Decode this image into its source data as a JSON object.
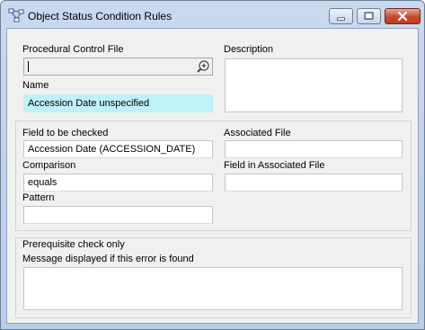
{
  "window": {
    "title": "Object Status Condition Rules",
    "icon": "flow-diagram-icon",
    "buttons": [
      "minimize-icon",
      "maximize-icon",
      "close-icon"
    ]
  },
  "form": {
    "procedural_control_file": {
      "label": "Procedural Control File",
      "value": "",
      "browse_icon": "zoom-in-icon"
    },
    "name": {
      "label": "Name",
      "value": "Accession Date unspecified"
    },
    "description": {
      "label": "Description",
      "value": ""
    },
    "field_to_check": {
      "label": "Field to be checked",
      "value": "Accession Date (ACCESSION_DATE)"
    },
    "comparison": {
      "label": "Comparison",
      "value": "equals"
    },
    "pattern": {
      "label": "Pattern",
      "value": ""
    },
    "associated_file": {
      "label": "Associated File",
      "value": ""
    },
    "field_in_associated_file": {
      "label": "Field in Associated File",
      "value": ""
    },
    "prerequisite": {
      "label": "Prerequisite check only"
    },
    "message": {
      "label": "Message displayed if this error is found",
      "value": ""
    }
  },
  "colors": {
    "name_field_background": "#bff1f8",
    "titlebar": "#c9d9ee",
    "close_button": "#c44a2f"
  }
}
